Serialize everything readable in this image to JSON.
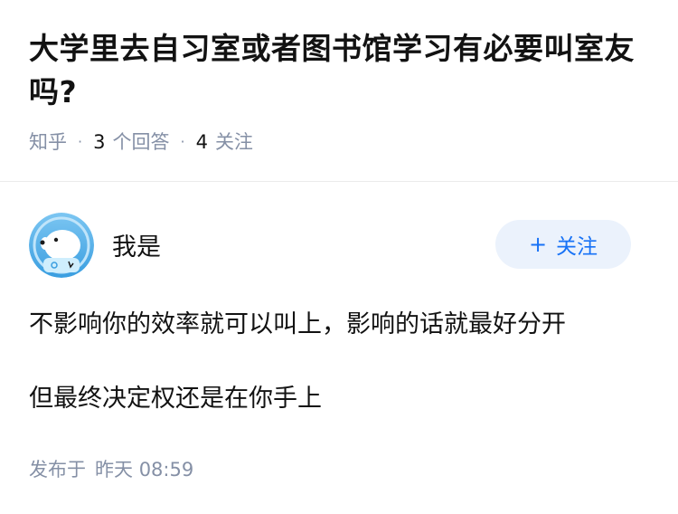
{
  "question": {
    "title": "大学里去自习室或者图书馆学习有必要叫室友吗?",
    "source": "知乎",
    "answer_count": "3",
    "answer_label": "个回答",
    "follow_count": "4",
    "follow_label": "关注"
  },
  "answer": {
    "author_name": "我是",
    "follow_button": {
      "icon": "plus-icon",
      "plus": "+",
      "label": "关注"
    },
    "paragraphs": [
      "不影响你的效率就可以叫上，影响的话就最好分开",
      "但最终决定权还是在你手上"
    ],
    "published_label": "发布于",
    "published_date": "昨天",
    "published_time": "08:59"
  },
  "colors": {
    "text": "#121212",
    "meta": "#8590a6",
    "accent": "#1772f6",
    "button_bg": "#ebf2fc",
    "divider": "#ebebeb"
  }
}
